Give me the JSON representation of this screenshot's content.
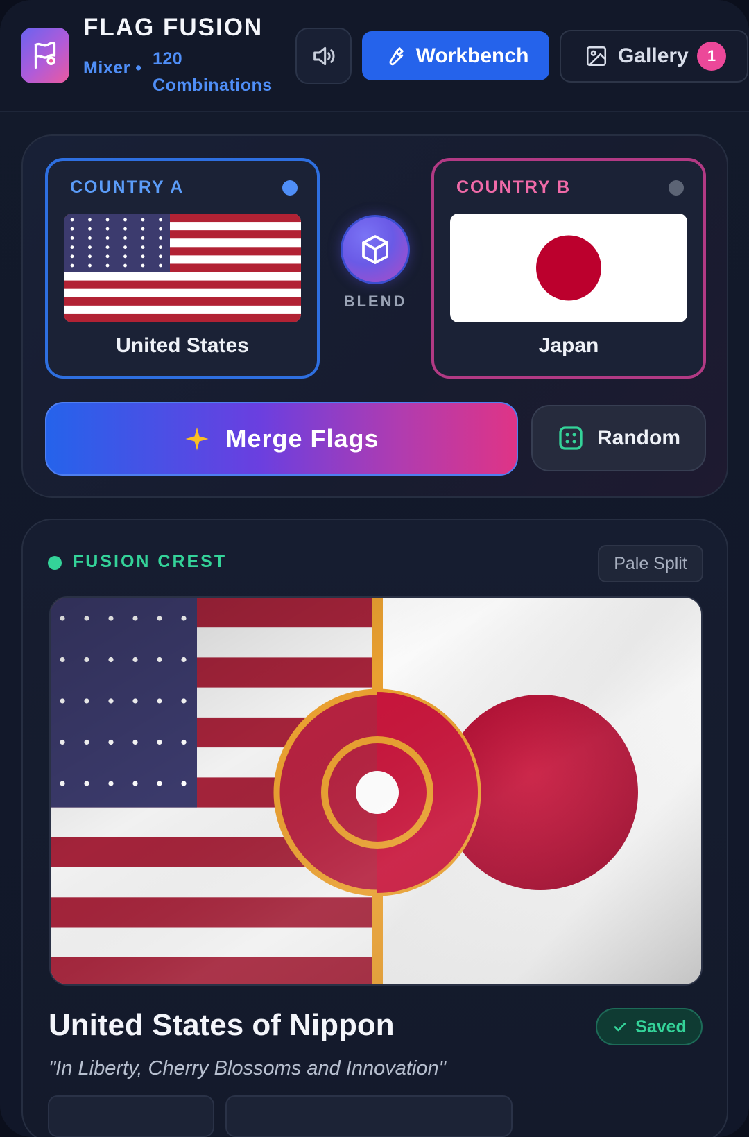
{
  "header": {
    "title": "FLAG FUSION",
    "subtitle_mode": "Mixer •",
    "subtitle_count": "120 Combinations",
    "workbench_label": "Workbench",
    "gallery_label": "Gallery",
    "gallery_count": "1"
  },
  "mixer": {
    "country_a": {
      "label": "COUNTRY A",
      "name": "United States",
      "accent": "#2e6fe0"
    },
    "country_b": {
      "label": "COUNTRY B",
      "name": "Japan",
      "accent": "#b23a84"
    },
    "blend_label": "BLEND",
    "merge_label": "Merge Flags",
    "random_label": "Random"
  },
  "result": {
    "section_title": "FUSION CREST",
    "style": "Pale Split",
    "name": "United States of Nippon",
    "motto": "\"In Liberty, Cherry Blossoms and Innovation\"",
    "status": "Saved"
  },
  "icons": {
    "logo": "flag-icon",
    "sound": "speaker-icon",
    "workbench": "wrench-icon",
    "gallery": "image-icon",
    "blend": "cube-icon",
    "merge": "sparkle-icon",
    "random": "dice-icon",
    "saved": "check-icon"
  },
  "colors": {
    "accent_blue": "#2563eb",
    "accent_pink": "#ec4899",
    "accent_green": "#34d399",
    "us_red": "#b22234",
    "us_blue": "#3c3b6e",
    "jp_red": "#bc002d"
  }
}
